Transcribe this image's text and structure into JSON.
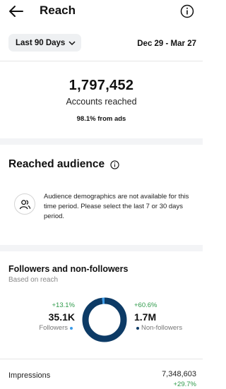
{
  "header": {
    "title": "Reach"
  },
  "date_range": {
    "selected": "Last 90 Days",
    "dates": "Dec 29 - Mar 27"
  },
  "summary": {
    "accounts_reached": "1,797,452",
    "label": "Accounts reached",
    "ads_share": "98.1% from ads"
  },
  "reached_audience": {
    "title": "Reached audience",
    "message": "Audience demographics are not available for this time period. Please select the last 7 or 30 days period."
  },
  "followers_section": {
    "title": "Followers and non-followers",
    "subtitle": "Based on reach",
    "followers": {
      "change": "+13.1%",
      "value": "35.1K",
      "label": "Followers",
      "share": 0.02
    },
    "non_followers": {
      "change": "+60.6%",
      "value": "1.7M",
      "label": "Non-followers",
      "share": 0.98
    },
    "colors": {
      "followers": "#3b9be8",
      "non_followers": "#0d3b66",
      "positive": "#2e9a4a"
    }
  },
  "impressions": {
    "label": "Impressions",
    "value": "7,348,603",
    "change": "+29.7%"
  }
}
